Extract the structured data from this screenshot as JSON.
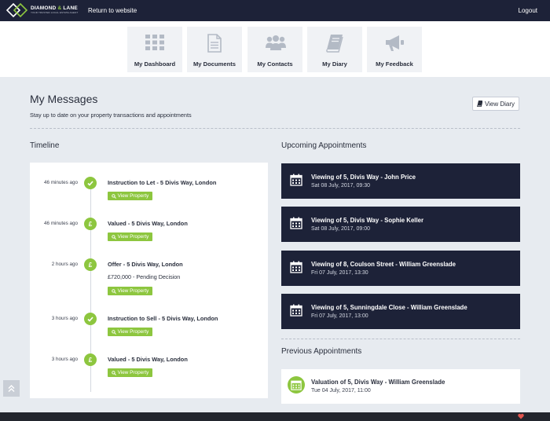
{
  "header": {
    "brand_name": "DIAMOND",
    "brand_amp": "&",
    "brand_name2": "LANE",
    "brand_tagline": "YOUR TRUSTED LOCAL ESTATE AGENT",
    "return_link": "Return to website",
    "logout": "Logout"
  },
  "nav": {
    "items": [
      {
        "label": "My Dashboard",
        "icon": "grid-icon"
      },
      {
        "label": "My Documents",
        "icon": "document-icon"
      },
      {
        "label": "My Contacts",
        "icon": "people-icon"
      },
      {
        "label": "My Diary",
        "icon": "book-icon"
      },
      {
        "label": "My Feedback",
        "icon": "megaphone-icon"
      }
    ]
  },
  "page": {
    "title": "My Messages",
    "subtitle": "Stay up to date on your property transactions and appointments",
    "view_diary": "View Diary"
  },
  "timeline": {
    "heading": "Timeline",
    "button_label": "View Property",
    "entries": [
      {
        "time": "46 minutes ago",
        "icon": "check-icon",
        "title": "Instruction to Let - 5 Divis Way, London",
        "detail": ""
      },
      {
        "time": "46 minutes ago",
        "icon": "pound-icon",
        "title": "Valued - 5 Divis Way, London",
        "detail": ""
      },
      {
        "time": "2 hours ago",
        "icon": "pound-icon",
        "title": "Offer - 5 Divis Way, London",
        "detail": "£720,000 - Pending Decision"
      },
      {
        "time": "3 hours ago",
        "icon": "check-icon",
        "title": "Instruction to Sell - 5 Divis Way, London",
        "detail": ""
      },
      {
        "time": "3 hours ago",
        "icon": "pound-icon",
        "title": "Valued - 5 Divis Way, London",
        "detail": ""
      }
    ]
  },
  "upcoming": {
    "heading": "Upcoming Appointments",
    "items": [
      {
        "title": "Viewing of 5, Divis Way - John Price",
        "date": "Sat 08 July, 2017, 09:30"
      },
      {
        "title": "Viewing of 5, Divis Way - Sophie Keller",
        "date": "Sat 08 July, 2017, 09:00"
      },
      {
        "title": "Viewing of 8, Coulson Street - William Greenslade",
        "date": "Fri 07 July, 2017, 13:30"
      },
      {
        "title": "Viewing of 5, Sunningdale Close - William Greenslade",
        "date": "Fri 07 July, 2017, 13:00"
      }
    ]
  },
  "previous": {
    "heading": "Previous Appointments",
    "items": [
      {
        "title": "Valuation of 5, Divis Way - William Greenslade",
        "date": "Tue 04 July, 2017, 11:00"
      }
    ]
  },
  "colors": {
    "navy": "#1d2238",
    "accent_green": "#8dc63f",
    "page_bg": "#e7ebf0"
  }
}
